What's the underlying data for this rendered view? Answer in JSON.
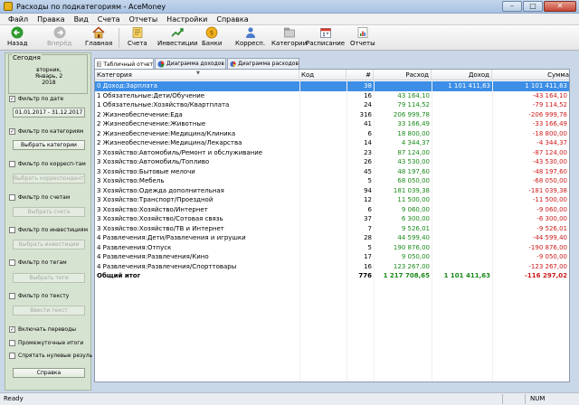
{
  "window": {
    "title": "Расходы по подкатегориям - AceMoney",
    "minimize": "–",
    "maximize": "□",
    "close": "✕"
  },
  "menu": [
    "Файл",
    "Правка",
    "Вид",
    "Счета",
    "Отчеты",
    "Настройки",
    "Справка"
  ],
  "toolbar": {
    "back": "Назад",
    "forward": "Вперёд",
    "home": "Главная",
    "accounts": "Счета",
    "investments": "Инвестиции",
    "banks": "Банки",
    "correspondents": "Корресп.",
    "categories": "Категории",
    "schedule": "Расписание",
    "reports": "Отчеты"
  },
  "sidebar": {
    "today_title": "Сегодня",
    "today_day": "вторник,",
    "today_date": "Январь, 2",
    "today_year": "2018",
    "filter_date": {
      "label": "Фильтр по дате",
      "checked": "✓"
    },
    "date_range": "01.01.2017 - 31.12.2017",
    "filter_categories": {
      "label": "Фильтр по категориям",
      "checked": "✓"
    },
    "choose_categories": "Выбрать категории",
    "filter_correspondents": {
      "label": "Фильтр по корресп-там",
      "checked": ""
    },
    "choose_correspondents": "Выбрать корреспондентов",
    "filter_accounts": {
      "label": "Фильтр по счетам",
      "checked": ""
    },
    "choose_accounts": "Выбрать счета",
    "filter_investments": {
      "label": "Фильтр по инвестициям",
      "checked": ""
    },
    "choose_investments": "Выбрать инвестиции",
    "filter_tags": {
      "label": "Фильтр по тегам",
      "checked": ""
    },
    "choose_tags": "Выбрать теги",
    "filter_text": {
      "label": "Фильтр по тексту",
      "checked": ""
    },
    "enter_text": "Ввести текст",
    "include_transfers": {
      "label": "Включать переводы",
      "checked": "✓"
    },
    "subtotals": {
      "label": "Промежуточные итоги",
      "checked": ""
    },
    "hide_zero": {
      "label": "Спрятать нулевые резуль",
      "checked": ""
    },
    "help": "Справка"
  },
  "tabs": [
    "Табличный отчет",
    "Диаграмма доходов",
    "Диаграмма расходов"
  ],
  "grid": {
    "headers": {
      "category": "Категория",
      "code": "Код",
      "count": "#",
      "expense": "Расход",
      "income": "Доход",
      "sum": "Сумма"
    },
    "rows": [
      {
        "category": "0 Доход:Зарплата",
        "code": "",
        "count": "38",
        "expense": "",
        "income": "1 101 411,63",
        "sum": "1 101 411,63"
      },
      {
        "category": "1 Обязательные:Дети/Обучение",
        "code": "",
        "count": "16",
        "expense": "43 164,10",
        "income": "",
        "sum": "-43 164,10"
      },
      {
        "category": "1 Обязательные:Хозяйство/Квартплата",
        "code": "",
        "count": "24",
        "expense": "79 114,52",
        "income": "",
        "sum": "-79 114,52"
      },
      {
        "category": "2 Жизнеобеспечение:Еда",
        "code": "",
        "count": "316",
        "expense": "206 999,78",
        "income": "",
        "sum": "-206 999,78"
      },
      {
        "category": "2 Жизнеобеспечение:Животные",
        "code": "",
        "count": "41",
        "expense": "33 166,49",
        "income": "",
        "sum": "-33 166,49"
      },
      {
        "category": "2 Жизнеобеспечение:Медицина/Клиника",
        "code": "",
        "count": "6",
        "expense": "18 800,00",
        "income": "",
        "sum": "-18 800,00"
      },
      {
        "category": "2 Жизнеобеспечение:Медицина/Лекарства",
        "code": "",
        "count": "14",
        "expense": "4 344,37",
        "income": "",
        "sum": "-4 344,37"
      },
      {
        "category": "3 Хозяйство:Автомобиль/Ремонт и обслуживание",
        "code": "",
        "count": "23",
        "expense": "87 124,00",
        "income": "",
        "sum": "-87 124,00"
      },
      {
        "category": "3 Хозяйство:Автомобиль/Топливо",
        "code": "",
        "count": "26",
        "expense": "43 530,00",
        "income": "",
        "sum": "-43 530,00"
      },
      {
        "category": "3 Хозяйство:Бытовые мелочи",
        "code": "",
        "count": "45",
        "expense": "48 197,60",
        "income": "",
        "sum": "-48 197,60"
      },
      {
        "category": "3 Хозяйство:Мебель",
        "code": "",
        "count": "5",
        "expense": "68 050,00",
        "income": "",
        "sum": "-68 050,00"
      },
      {
        "category": "3 Хозяйство:Одежда дополнительная",
        "code": "",
        "count": "94",
        "expense": "181 039,38",
        "income": "",
        "sum": "-181 039,38"
      },
      {
        "category": "3 Хозяйство:Транспорт/Проездной",
        "code": "",
        "count": "12",
        "expense": "11 500,00",
        "income": "",
        "sum": "-11 500,00"
      },
      {
        "category": "3 Хозяйство:Хозяйство/Интернет",
        "code": "",
        "count": "6",
        "expense": "9 060,00",
        "income": "",
        "sum": "-9 060,00"
      },
      {
        "category": "3 Хозяйство:Хозяйство/Сотовая связь",
        "code": "",
        "count": "37",
        "expense": "6 300,00",
        "income": "",
        "sum": "-6 300,00"
      },
      {
        "category": "3 Хозяйство:Хозяйство/ТВ и Интернет",
        "code": "",
        "count": "7",
        "expense": "9 526,01",
        "income": "",
        "sum": "-9 526,01"
      },
      {
        "category": "4 Развлечения:Дети/Развлечения и игрушки",
        "code": "",
        "count": "28",
        "expense": "44 599,40",
        "income": "",
        "sum": "-44 599,40"
      },
      {
        "category": "4 Развлечения:Отпуск",
        "code": "",
        "count": "5",
        "expense": "190 876,00",
        "income": "",
        "sum": "-190 876,00"
      },
      {
        "category": "4 Развлечения:Развлечения/Кино",
        "code": "",
        "count": "17",
        "expense": "9 050,00",
        "income": "",
        "sum": "-9 050,00"
      },
      {
        "category": "4 Развлечения:Развлечения/Спорттовары",
        "code": "",
        "count": "16",
        "expense": "123 267,00",
        "income": "",
        "sum": "-123 267,00"
      }
    ],
    "total": {
      "category": "Общий итог",
      "code": "",
      "count": "776",
      "expense": "1 217 708,65",
      "income": "1 101 411,63",
      "sum": "-116 297,02"
    }
  },
  "status": {
    "left": "Ready",
    "num": "NUM"
  },
  "colors": {
    "selected_row": "#3c8ee6",
    "expense": "#1a8a1a",
    "negative": "#cc1a1a"
  }
}
